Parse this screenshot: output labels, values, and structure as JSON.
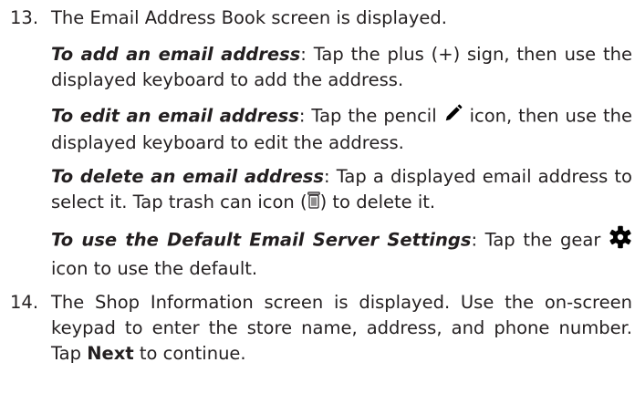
{
  "steps": [
    {
      "number": "13.",
      "text": "The Email Address Book screen is displayed."
    },
    {
      "number": "14.",
      "text_pre": "The Shop Information screen is displayed.  Use the on-screen keypad to enter the store name, address, and phone number.  Tap ",
      "bold": "Next",
      "text_post": " to continue."
    }
  ],
  "instructions": {
    "add": {
      "title": "To add an email address",
      "text": ": Tap the plus (+) sign, then use the displayed keyboard to add the address."
    },
    "edit": {
      "title": "To edit an email address",
      "text_pre": ": Tap the pencil ",
      "text_post": " icon, then use the displayed keyboard to edit the address."
    },
    "delete": {
      "title": "To delete an email address",
      "text_pre": ": Tap a displayed email address to select it.  Tap trash can icon (",
      "text_post": ") to delete it."
    },
    "gear": {
      "title": "To use the Default Email Server Settings",
      "text_pre": ": Tap the gear ",
      "text_post": " icon to use the default."
    }
  },
  "icons": {
    "pencil": "pencil-icon",
    "trash": "trash-can-icon",
    "gear": "gear-icon"
  }
}
